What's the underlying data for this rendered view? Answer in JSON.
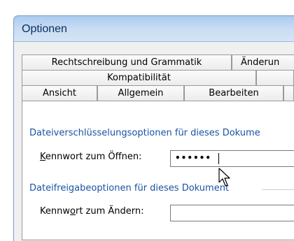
{
  "window": {
    "title": "Optionen"
  },
  "tabs": {
    "row1": [
      "Rechtschreibung und Grammatik",
      "Änderun"
    ],
    "row2": [
      "Kompatibilität"
    ],
    "row3": [
      "Ansicht",
      "Allgemein",
      "Bearbeiten"
    ]
  },
  "panel": {
    "encryption_section": "Dateiverschlüsselungsoptionen für dieses Dokume",
    "open_password": {
      "label_hot": "K",
      "label_rest": "ennwort zum Öffnen:",
      "value": "••••••"
    },
    "sharing_section": "Dateifreigabeoptionen für dieses Dokument",
    "modify_password": {
      "label_before": "Kennw",
      "label_hot": "o",
      "label_after": "rt zum Ändern:",
      "value": ""
    }
  }
}
